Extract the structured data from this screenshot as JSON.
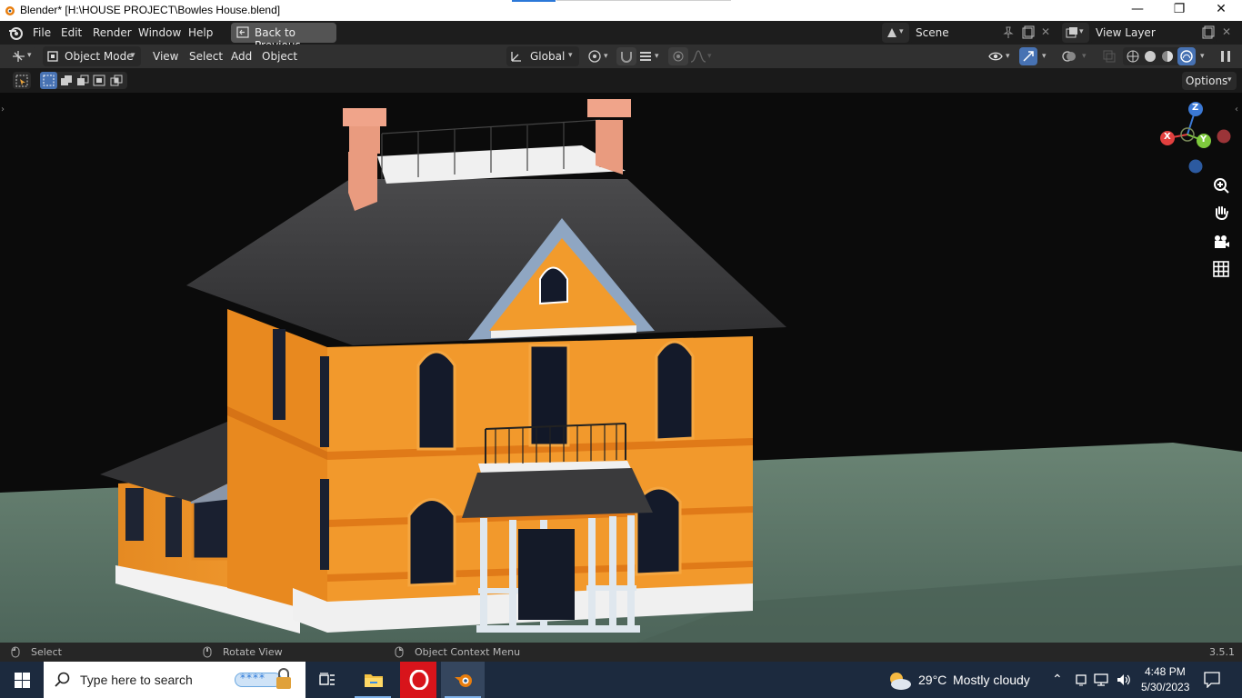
{
  "window": {
    "title": "Blender* [H:\\HOUSE PROJECT\\Bowles House.blend]",
    "minimize_glyph": "—",
    "restore_glyph": "❐",
    "close_glyph": "✕"
  },
  "topbar": {
    "menus": [
      "File",
      "Edit",
      "Render",
      "Window",
      "Help"
    ],
    "back_button": "Back to Previous",
    "scene": "Scene",
    "view_layer": "View Layer"
  },
  "header": {
    "mode": "Object Mode",
    "menus": [
      "View",
      "Select",
      "Add",
      "Object"
    ],
    "orientation": "Global",
    "options": "Options"
  },
  "gizmo": {
    "z": "Z",
    "x": "X",
    "y": "Y",
    "colors": {
      "x": "#e2403f",
      "y": "#7ec93d",
      "z": "#3b79d6",
      "neg": "#2c5aa0"
    }
  },
  "statusbar": {
    "select": "Select",
    "rotate": "Rotate View",
    "context": "Object Context Menu",
    "version": "3.5.1"
  },
  "taskbar": {
    "search_placeholder": "Type here to search",
    "weather_temp": "29°C",
    "weather_desc": "Mostly cloudy",
    "time": "4:48 PM",
    "date": "5/30/2023"
  },
  "icons": [
    "blender-logo-icon",
    "windows-start-icon",
    "search-icon",
    "task-view-icon",
    "file-explorer-icon",
    "opera-icon",
    "blender-taskbar-icon",
    "weather-icon",
    "zoom-icon",
    "hand-icon",
    "camera-icon",
    "grid-icon"
  ],
  "colors": {
    "house_wall": "#f0962a",
    "roof": "#3a3a3c",
    "ground": "#5e7868",
    "chimney": "#e89a80",
    "trim": "#e8e8e8"
  }
}
